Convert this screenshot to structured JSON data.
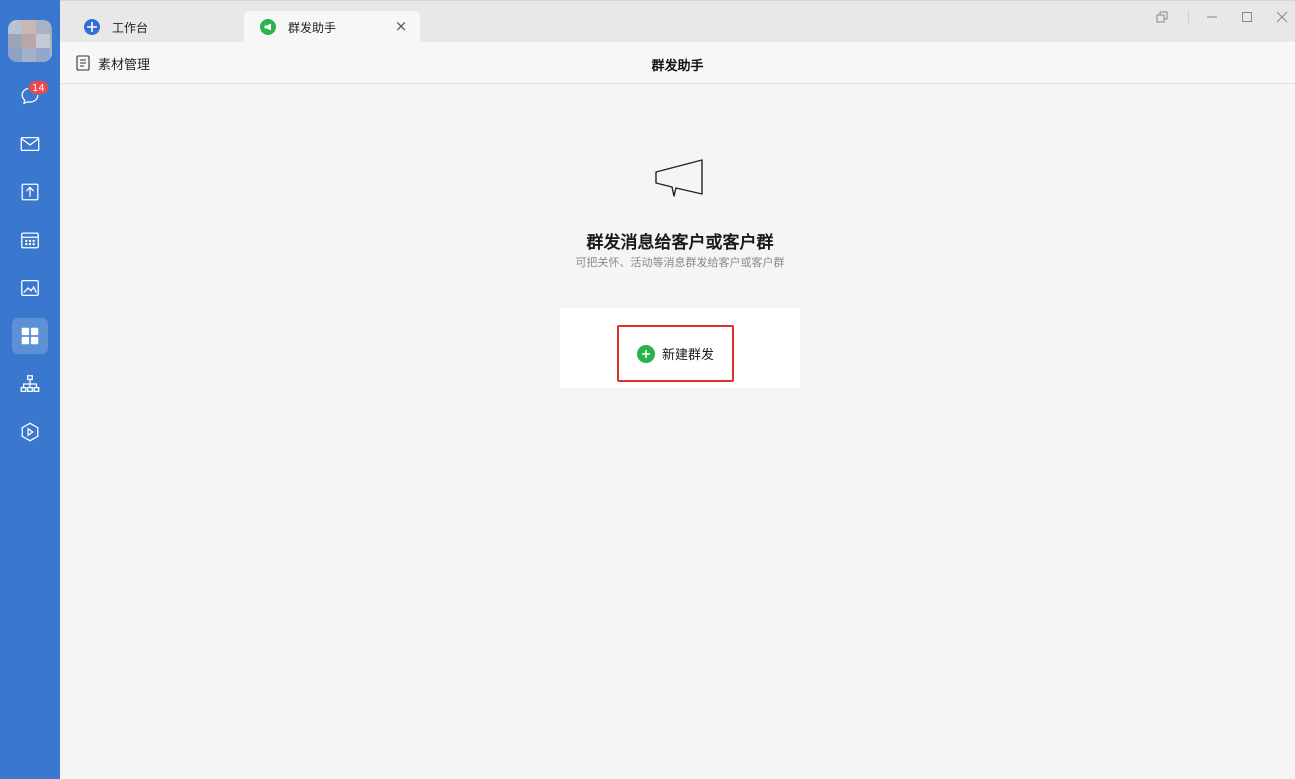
{
  "sidebar": {
    "badge_count": "14",
    "items": [
      {
        "name": "chat-icon"
      },
      {
        "name": "mail-icon"
      },
      {
        "name": "docs-icon"
      },
      {
        "name": "calendar-icon"
      },
      {
        "name": "meeting-icon"
      },
      {
        "name": "workbench-icon"
      },
      {
        "name": "org-chart-icon"
      },
      {
        "name": "apps-icon"
      }
    ],
    "active_item": "workbench-icon",
    "accent": "#3a78cf"
  },
  "tabs": [
    {
      "label": "工作台",
      "icon": "workbench-logo-icon",
      "active": false
    },
    {
      "label": "群发助手",
      "icon": "broadcast-icon",
      "active": true,
      "closable": true
    }
  ],
  "window_controls": [
    "restore-window-icon",
    "minimize-icon",
    "maximize-icon",
    "close-icon"
  ],
  "header": {
    "material_label": "素材管理",
    "title": "群发助手"
  },
  "empty_state": {
    "icon": "megaphone-icon",
    "headline": "群发消息给客户或客户群",
    "description": "可把关怀、活动等消息群发给客户或客户群",
    "button_label": "新建群发",
    "button_accent": "#2bb24c",
    "highlight_color": "#e0302e"
  }
}
